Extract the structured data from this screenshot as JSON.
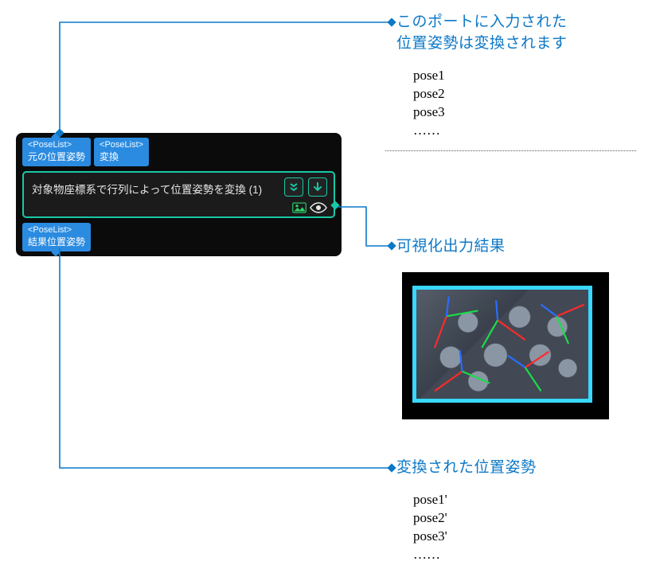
{
  "node": {
    "inputPorts": [
      {
        "type": "<PoseList>",
        "label": "元の位置姿勢"
      },
      {
        "type": "<PoseList>",
        "label": "変換"
      }
    ],
    "title": "対象物座標系で行列によって位置姿勢を変換 (1)",
    "outputPorts": [
      {
        "type": "<PoseList>",
        "label": "結果位置姿勢"
      }
    ]
  },
  "annotations": {
    "input": {
      "line1": "このポートに入力された",
      "line2": "位置姿勢は変換されます",
      "items": [
        "pose1",
        "pose2",
        "pose3",
        "……"
      ]
    },
    "vis": {
      "title": "可視化出力結果"
    },
    "output": {
      "title": "変換された位置姿勢",
      "items": [
        "pose1'",
        "pose2'",
        "pose3'",
        "……"
      ]
    }
  }
}
